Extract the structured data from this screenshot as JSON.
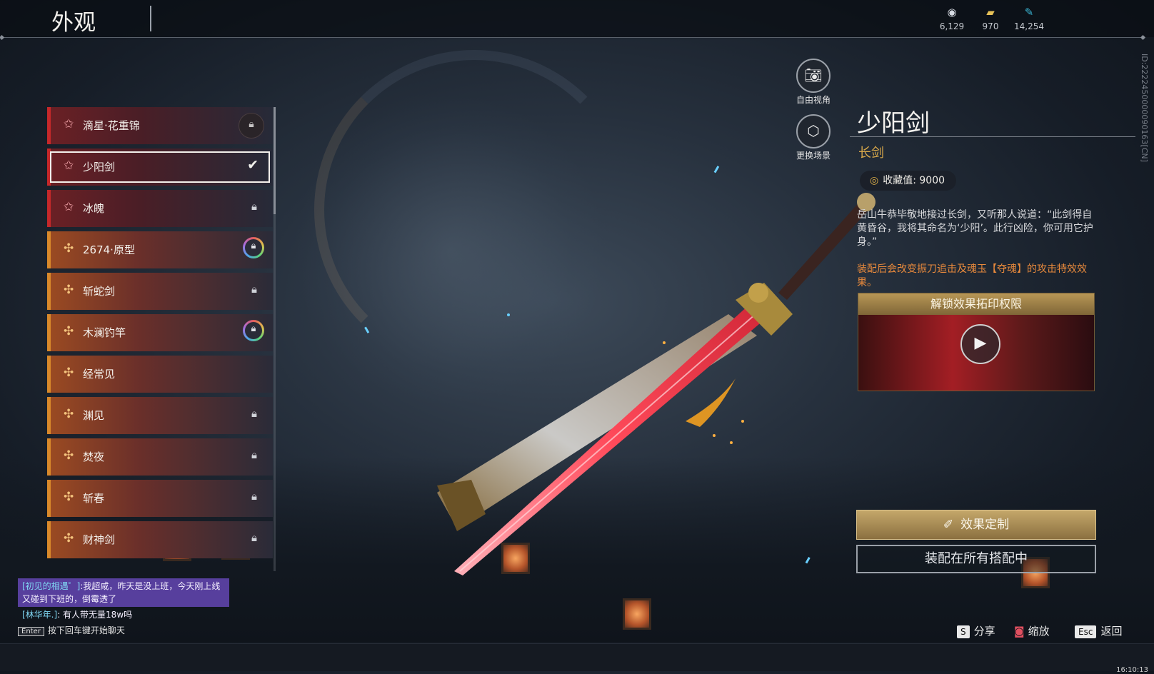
{
  "header": {
    "title": "外观",
    "currencies": [
      {
        "icon": "coin-icon",
        "value": "6,129"
      },
      {
        "icon": "ticket-icon",
        "value": "970"
      },
      {
        "icon": "feather-icon",
        "value": "14,254"
      }
    ]
  },
  "skin_list": [
    {
      "label": "滴星·花重锦",
      "rarity": "red",
      "state": "locked-badge"
    },
    {
      "label": "少阳剑",
      "rarity": "red",
      "state": "equipped"
    },
    {
      "label": "冰魄",
      "rarity": "red",
      "state": "locked"
    },
    {
      "label": "2674·原型",
      "rarity": "orange",
      "state": "locked-ring"
    },
    {
      "label": "斩蛇剑",
      "rarity": "orange",
      "state": "locked"
    },
    {
      "label": "木澜钓竿",
      "rarity": "orange",
      "state": "locked-ring"
    },
    {
      "label": "经常见",
      "rarity": "orange",
      "state": "none"
    },
    {
      "label": "渊见",
      "rarity": "orange",
      "state": "locked"
    },
    {
      "label": "焚夜",
      "rarity": "orange",
      "state": "locked"
    },
    {
      "label": "斩春",
      "rarity": "orange",
      "state": "locked"
    },
    {
      "label": "财神剑",
      "rarity": "orange",
      "state": "locked"
    }
  ],
  "camera": {
    "free_view": "自由视角",
    "change_scene": "更换场景"
  },
  "detail": {
    "name": "少阳剑",
    "type": "长剑",
    "collect_label": "收藏值: 9000",
    "description": "岳山牛恭毕敬地接过长剑，又听那人说道：“此剑得自黄昏谷，我将其命名为‘少阳’。此行凶险，你可用它护身。”",
    "effect": "装配后会改变振刀追击及魂玉【夺魂】的攻击特效效果。",
    "unlock_title": "解锁效果拓印权限",
    "customize_label": "效果定制",
    "equip_label": "装配在所有搭配中",
    "id_text": "ID:2222450000090163[CN]"
  },
  "chat": {
    "line1_tag": "[初见的相遇゜]",
    "line1_text": ":我超咸，昨天是没上班，今天刚上线又碰到下班的，倒霉透了",
    "line2_tag": "[林华年.]",
    "line2_text": ": 有人带无量18w吗",
    "enter_key": "Enter",
    "hint": "按下回车键开始聊天"
  },
  "hints": [
    {
      "key": "S",
      "label": "分享"
    },
    {
      "key": "",
      "label": "缩放"
    },
    {
      "key": "Esc",
      "label": "返回"
    }
  ],
  "clock": "16:10:13"
}
